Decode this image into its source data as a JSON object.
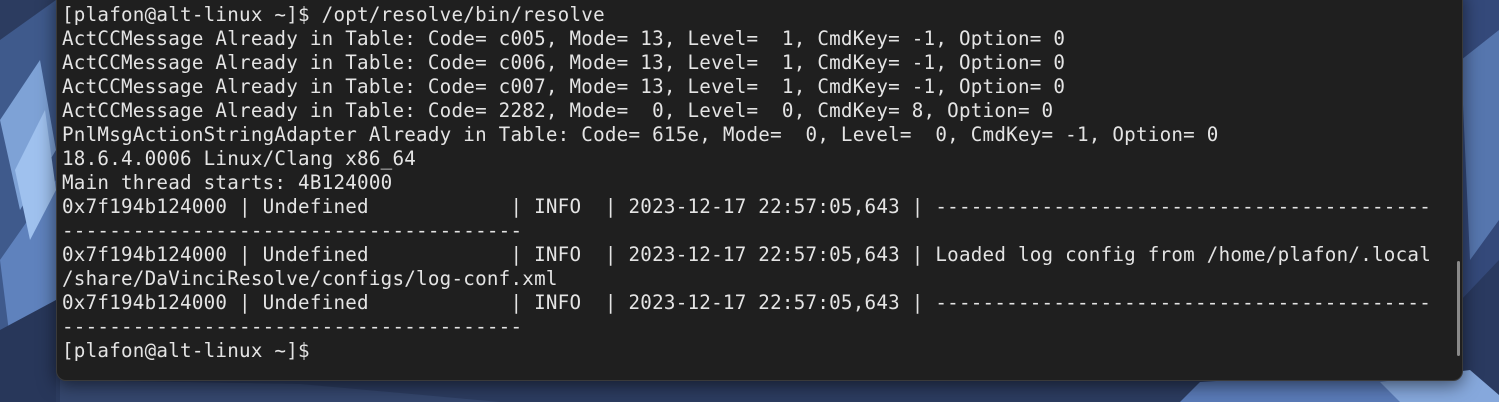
{
  "terminal": {
    "lines": [
      "[plafon@alt-linux ~]$ /opt/resolve/bin/resolve",
      "ActCCMessage Already in Table: Code= c005, Mode= 13, Level=  1, CmdKey= -1, Option= 0",
      "ActCCMessage Already in Table: Code= c006, Mode= 13, Level=  1, CmdKey= -1, Option= 0",
      "ActCCMessage Already in Table: Code= c007, Mode= 13, Level=  1, CmdKey= -1, Option= 0",
      "ActCCMessage Already in Table: Code= 2282, Mode=  0, Level=  0, CmdKey= 8, Option= 0",
      "PnlMsgActionStringAdapter Already in Table: Code= 615e, Mode=  0, Level=  0, CmdKey= -1, Option= 0",
      "18.6.4.0006 Linux/Clang x86_64",
      "Main thread starts: 4B124000",
      "0x7f194b124000 | Undefined            | INFO  | 2023-12-17 22:57:05,643 | ------------------------------------------",
      "---------------------------------------",
      "0x7f194b124000 | Undefined            | INFO  | 2023-12-17 22:57:05,643 | Loaded log config from /home/plafon/.local",
      "/share/DaVinciResolve/configs/log-conf.xml",
      "0x7f194b124000 | Undefined            | INFO  | 2023-12-17 22:57:05,643 | ------------------------------------------",
      "---------------------------------------",
      "[plafon@alt-linux ~]$ "
    ]
  },
  "colors": {
    "terminal_background": "#1f1f1f",
    "terminal_text": "#e4e4e4",
    "wallpaper_base": "#2c3c60"
  }
}
